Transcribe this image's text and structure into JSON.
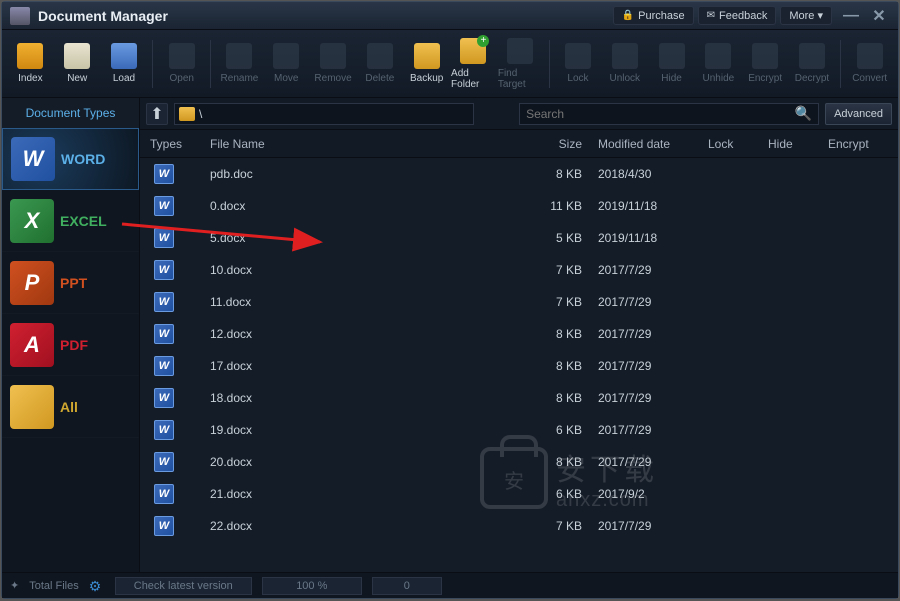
{
  "app": {
    "title": "Document Manager"
  },
  "titlebar_links": [
    {
      "icon": "🔒",
      "label": "Purchase"
    },
    {
      "icon": "✉",
      "label": "Feedback"
    },
    {
      "icon": "",
      "label": "More ▾"
    }
  ],
  "toolbar": [
    {
      "label": "Index",
      "color": "linear-gradient(#f0b030,#d08810)",
      "enabled": true
    },
    {
      "label": "New",
      "color": "linear-gradient(#e8e4d0,#c8c4a8)",
      "enabled": true
    },
    {
      "label": "Load",
      "color": "linear-gradient(#6a9ae0,#3a6ab8)",
      "enabled": true
    },
    {
      "label": "Open",
      "color": "#3a4656",
      "enabled": false,
      "sep_before": true
    },
    {
      "label": "Rename",
      "color": "#3a4656",
      "enabled": false,
      "sep_before": true
    },
    {
      "label": "Move",
      "color": "#3a4656",
      "enabled": false
    },
    {
      "label": "Remove",
      "color": "#3a4656",
      "enabled": false
    },
    {
      "label": "Delete",
      "color": "#3a4656",
      "enabled": false
    },
    {
      "label": "Backup",
      "color": "linear-gradient(#f0c050,#d09820)",
      "enabled": true
    },
    {
      "label": "Add Folder",
      "color": "linear-gradient(#f0c050,#d09820)",
      "enabled": true,
      "badge": "+"
    },
    {
      "label": "Find Target",
      "color": "#3a4656",
      "enabled": false
    },
    {
      "label": "Lock",
      "color": "#3a4656",
      "enabled": false,
      "sep_before": true
    },
    {
      "label": "Unlock",
      "color": "#3a4656",
      "enabled": false
    },
    {
      "label": "Hide",
      "color": "#3a4656",
      "enabled": false
    },
    {
      "label": "Unhide",
      "color": "#3a4656",
      "enabled": false
    },
    {
      "label": "Encrypt",
      "color": "#3a4656",
      "enabled": false
    },
    {
      "label": "Decrypt",
      "color": "#3a4656",
      "enabled": false
    },
    {
      "label": "Convert",
      "color": "#3a4656",
      "enabled": false,
      "sep_before": true
    }
  ],
  "sidebar": {
    "title": "Document Types",
    "items": [
      {
        "label": "WORD",
        "color": "#5cb0e8",
        "icon_bg": "linear-gradient(135deg,#3a6ab8,#2050a0)",
        "icon_txt": "W",
        "active": true
      },
      {
        "label": "EXCEL",
        "color": "#40b060",
        "icon_bg": "linear-gradient(135deg,#3a9850,#207030)",
        "icon_txt": "X",
        "active": false
      },
      {
        "label": "PPT",
        "color": "#d05020",
        "icon_bg": "linear-gradient(135deg,#d05020,#a03810)",
        "icon_txt": "P",
        "active": false
      },
      {
        "label": "PDF",
        "color": "#d02030",
        "icon_bg": "linear-gradient(135deg,#d02030,#a01020)",
        "icon_txt": "A",
        "active": false
      },
      {
        "label": "All",
        "color": "#d0a830",
        "icon_bg": "linear-gradient(135deg,#f0c050,#d09820)",
        "icon_txt": "",
        "active": false
      }
    ]
  },
  "path": "\\",
  "search": {
    "placeholder": "Search"
  },
  "advanced_label": "Advanced",
  "columns": {
    "types": "Types",
    "name": "File Name",
    "size": "Size",
    "date": "Modified date",
    "lock": "Lock",
    "hide": "Hide",
    "enc": "Encrypt"
  },
  "files": [
    {
      "name": "pdb.doc",
      "size": "8 KB",
      "date": "2018/4/30"
    },
    {
      "name": "0.docx",
      "size": "11 KB",
      "date": "2019/11/18"
    },
    {
      "name": "5.docx",
      "size": "5 KB",
      "date": "2019/11/18"
    },
    {
      "name": "10.docx",
      "size": "7 KB",
      "date": "2017/7/29"
    },
    {
      "name": "11.docx",
      "size": "7 KB",
      "date": "2017/7/29"
    },
    {
      "name": "12.docx",
      "size": "8 KB",
      "date": "2017/7/29"
    },
    {
      "name": "17.docx",
      "size": "8 KB",
      "date": "2017/7/29"
    },
    {
      "name": "18.docx",
      "size": "8 KB",
      "date": "2017/7/29"
    },
    {
      "name": "19.docx",
      "size": "6 KB",
      "date": "2017/7/29"
    },
    {
      "name": "20.docx",
      "size": "8 KB",
      "date": "2017/7/29"
    },
    {
      "name": "21.docx",
      "size": "6 KB",
      "date": "2017/9/2"
    },
    {
      "name": "22.docx",
      "size": "7 KB",
      "date": "2017/7/29"
    }
  ],
  "status": {
    "total_label": "Total Files",
    "check_label": "Check latest version",
    "progress": "100 %",
    "count": "0"
  },
  "watermark": {
    "cn": "安下载",
    "en": "anxz.com"
  }
}
